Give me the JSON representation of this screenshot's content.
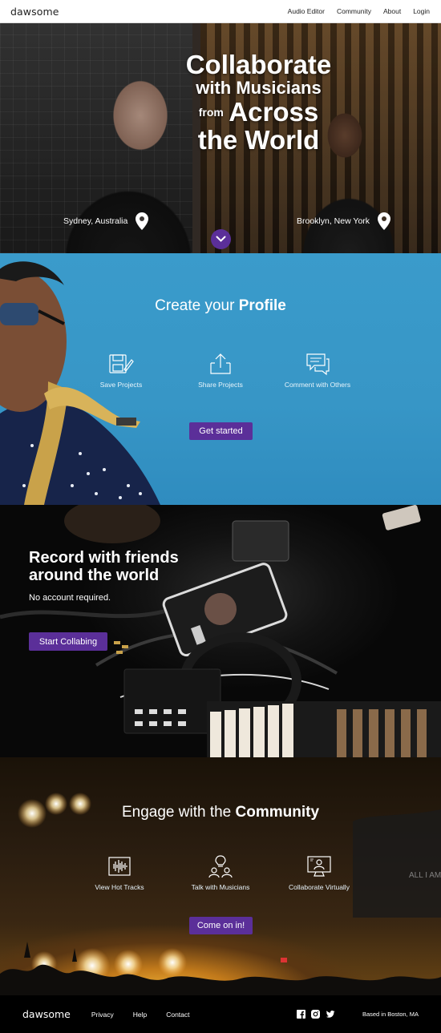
{
  "nav": {
    "logo": "dawsome",
    "links": [
      "Audio Editor",
      "Community",
      "About",
      "Login"
    ]
  },
  "hero": {
    "title_line1": "Collaborate",
    "title_line2": "with Musicians",
    "title_from": "from",
    "title_across": "Across",
    "title_line4": "the World",
    "location_left": "Sydney, Australia",
    "location_right": "Brooklyn, New York",
    "scroll_icon": "chevron-down-icon"
  },
  "profile": {
    "title_prefix": "Create your",
    "title_bold": "Profile",
    "features": [
      {
        "label": "Save Projects",
        "icon": "save-project-icon"
      },
      {
        "label": "Share Projects",
        "icon": "share-icon"
      },
      {
        "label": "Comment with Others",
        "icon": "comment-icon"
      }
    ],
    "cta": "Get started"
  },
  "record": {
    "title_line1": "Record with friends",
    "title_line2": "around the world",
    "subtitle": "No account required.",
    "cta": "Start Collabing"
  },
  "community": {
    "title_prefix": "Engage with the",
    "title_bold": "Community",
    "features": [
      {
        "label": "View Hot Tracks",
        "icon": "waveform-icon"
      },
      {
        "label": "Talk with Musicians",
        "icon": "people-idea-icon"
      },
      {
        "label": "Collaborate Virtually",
        "icon": "monitor-user-icon"
      }
    ],
    "cta": "Come on in!"
  },
  "footer": {
    "logo": "dawsome",
    "links": [
      "Privacy",
      "Help",
      "Contact"
    ],
    "social": [
      "facebook-icon",
      "instagram-icon",
      "twitter-icon"
    ],
    "based": "Based in Boston, MA"
  },
  "colors": {
    "accent": "#5b2f99",
    "profile_bg": "#3796c6",
    "nav_bg": "#ffffff",
    "footer_bg": "#000000"
  }
}
